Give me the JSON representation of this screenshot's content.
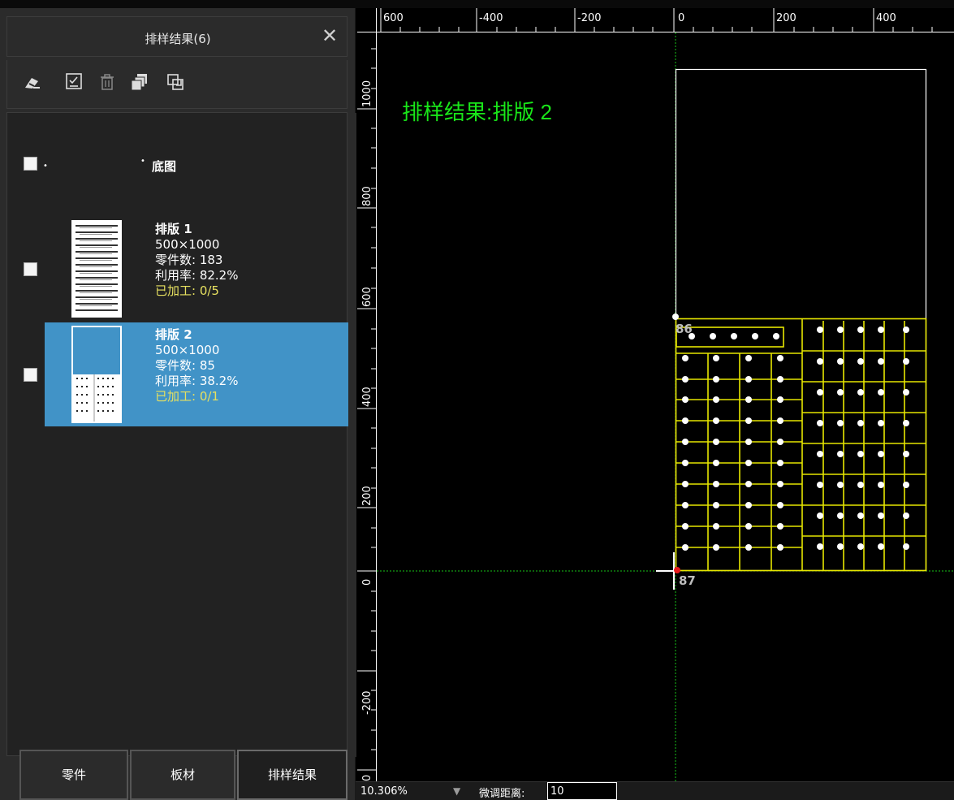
{
  "panel": {
    "title": "排样结果(6)",
    "close_icon": "close-icon",
    "toolbar": [
      {
        "name": "eraser-icon"
      },
      {
        "name": "checklist-icon"
      },
      {
        "name": "trash-icon"
      },
      {
        "name": "copy-stack-icon"
      },
      {
        "name": "export-icon"
      }
    ],
    "base_label": "底图",
    "items": [
      {
        "title": "排版 1",
        "size": "500×1000",
        "parts": "零件数: 183",
        "usage": "利用率: 82.2%",
        "processed": "已加工: 0/5",
        "selected": false
      },
      {
        "title": "排版 2",
        "size": "500×1000",
        "parts": "零件数: 85",
        "usage": "利用率: 38.2%",
        "processed": "已加工: 0/1",
        "selected": true
      }
    ],
    "tabs": [
      {
        "label": "零件",
        "active": false
      },
      {
        "label": "板材",
        "active": false
      },
      {
        "label": "排样结果",
        "active": true
      }
    ]
  },
  "canvas": {
    "label": "排样结果:排版 2",
    "ruler_top": [
      "600",
      "-400",
      "-200",
      "0",
      "200",
      "400"
    ],
    "ruler_left": [
      "1000",
      "800",
      "600",
      "400",
      "200",
      "0",
      "-200",
      "0"
    ],
    "point_labels": [
      "86",
      "87"
    ],
    "colors": {
      "label": "#19e619",
      "parts": "#e6e600",
      "sheet": "#ffffff",
      "axis": "#19c219"
    }
  },
  "status": {
    "zoom": "10.306%",
    "fine_label": "微调距离:",
    "fine_value": "10"
  }
}
